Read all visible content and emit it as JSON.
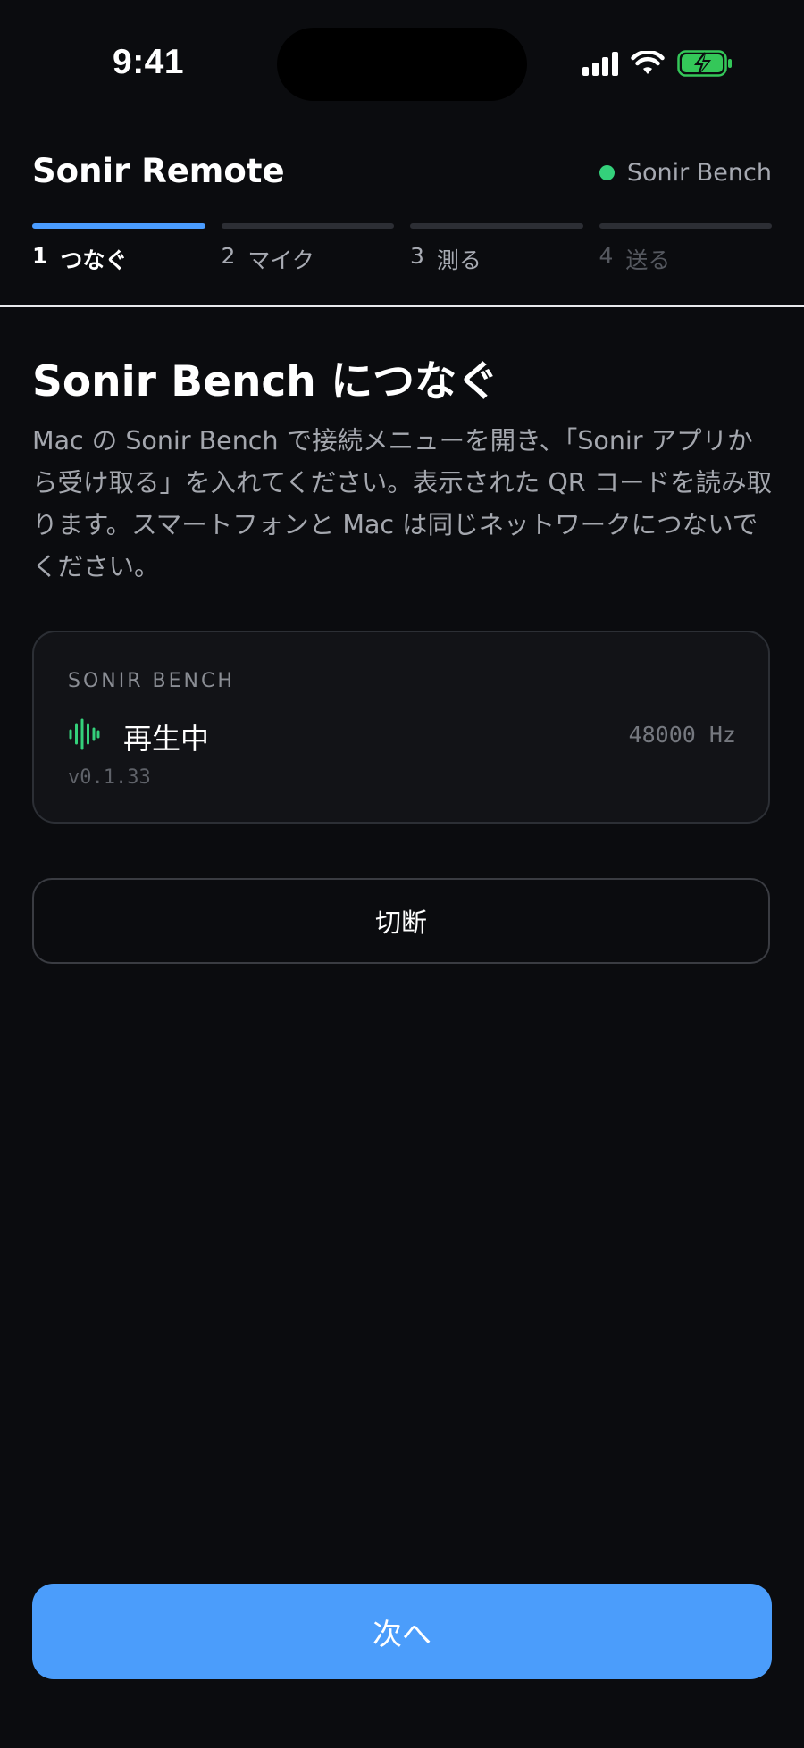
{
  "status_bar": {
    "time": "9:41",
    "icons": [
      "cellular-signal-icon",
      "wifi-icon",
      "battery-charging-icon"
    ]
  },
  "header": {
    "title": "Sonir Remote",
    "connection": {
      "label": "Sonir Bench",
      "status_color": "#34d17b"
    }
  },
  "stepper": {
    "steps": [
      {
        "number": "1",
        "label": "つなぐ",
        "state": "active"
      },
      {
        "number": "2",
        "label": "マイク",
        "state": "normal"
      },
      {
        "number": "3",
        "label": "測る",
        "state": "normal"
      },
      {
        "number": "4",
        "label": "送る",
        "state": "upcoming"
      }
    ]
  },
  "main": {
    "title": "Sonir Bench につなぐ",
    "description": "Mac の Sonir Bench で接続メニューを開き、「Sonir アプリから受け取る」を入れてください。表示された QR コードを読み取ります。スマートフォンと Mac は同じネットワークにつないでください。",
    "device_card": {
      "label": "SONIR BENCH",
      "state": "再生中",
      "sample_rate": "48000 Hz",
      "version": "v0.1.33",
      "icon": "waveform-icon"
    },
    "disconnect_label": "切断"
  },
  "footer": {
    "next_label": "次へ"
  },
  "colors": {
    "background": "#0b0c0f",
    "accent": "#4b9dfb",
    "success": "#34d17b"
  }
}
